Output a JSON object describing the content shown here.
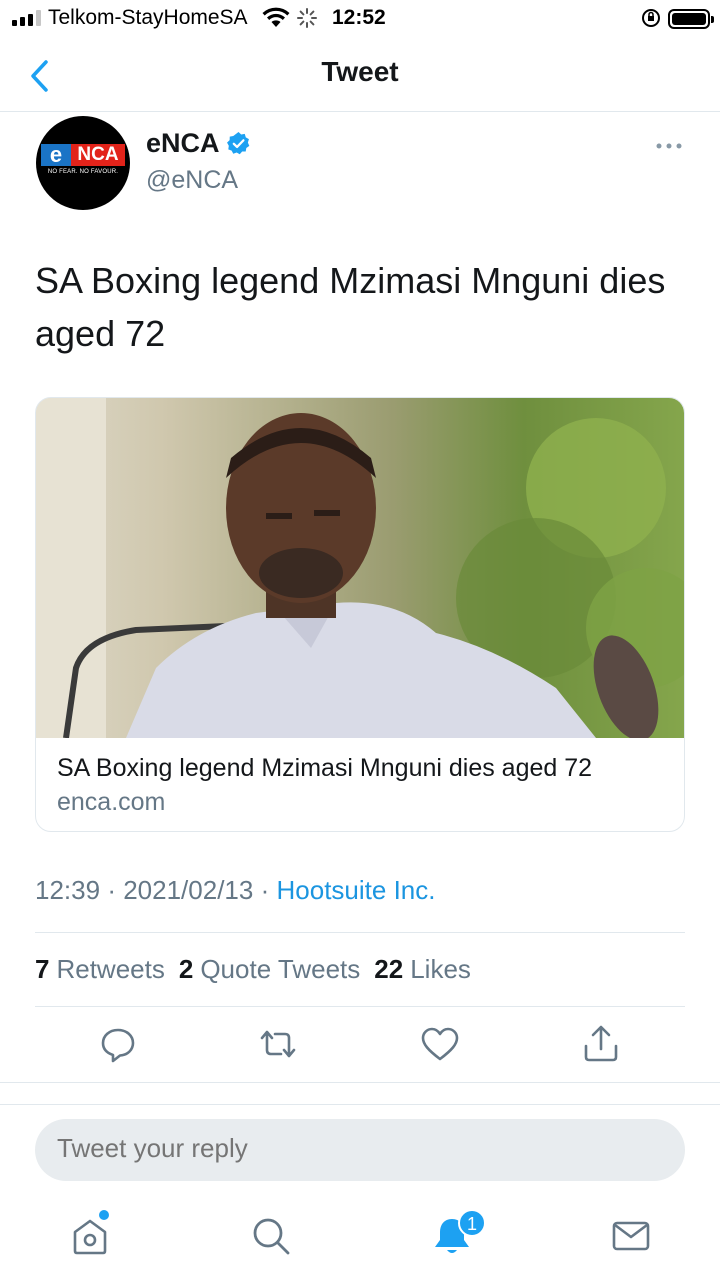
{
  "status_bar": {
    "carrier": "Telkom-StayHomeSA",
    "time": "12:52"
  },
  "nav": {
    "title": "Tweet"
  },
  "author": {
    "name": "eNCA",
    "handle": "@eNCA",
    "logo_text_e": "e",
    "logo_text_nca": "NCA",
    "logo_tagline": "NO FEAR. NO FAVOUR."
  },
  "tweet": {
    "text": "SA Boxing legend Mzimasi Mnguni dies aged 72"
  },
  "card": {
    "title": "SA Boxing legend Mzimasi Mnguni dies aged 72",
    "domain": "enca.com"
  },
  "meta": {
    "time": "12:39",
    "separator": "·",
    "date": "2021/02/13",
    "source": "Hootsuite Inc."
  },
  "stats": {
    "retweets_count": "7",
    "retweets_label": "Retweets",
    "quotes_count": "2",
    "quotes_label": "Quote Tweets",
    "likes_count": "22",
    "likes_label": "Likes"
  },
  "reply": {
    "placeholder": "Tweet your reply"
  },
  "tabbar": {
    "notifications_badge": "1"
  },
  "colors": {
    "accent": "#1da1f2",
    "link": "#1b95e0",
    "secondary_text": "#657786",
    "divider": "#e1e8ed"
  }
}
